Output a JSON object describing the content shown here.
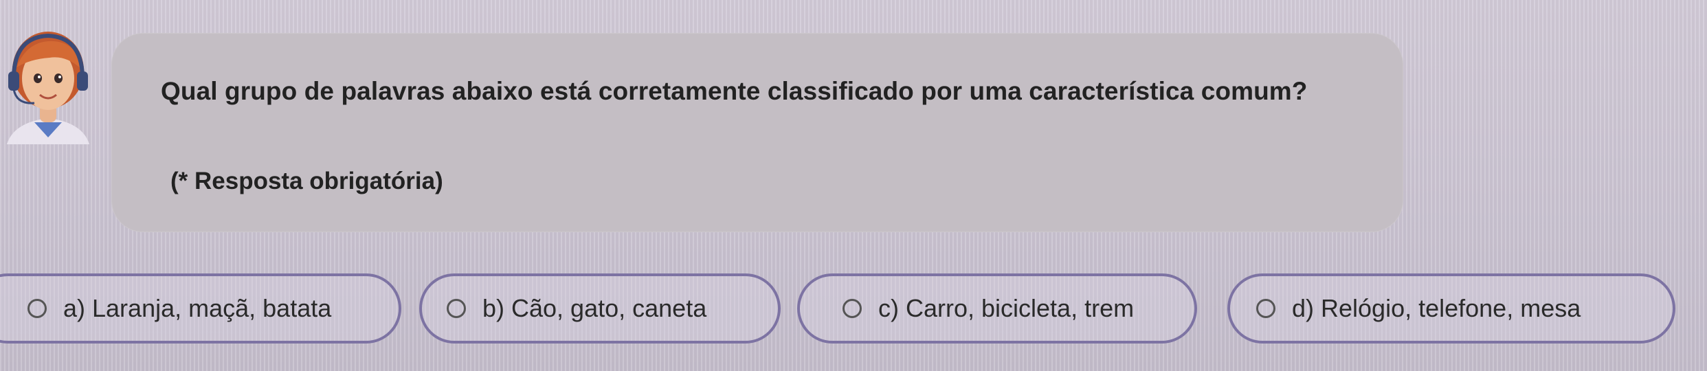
{
  "question": {
    "text": "Qual grupo de palavras abaixo está corretamente classificado por uma característica comum?",
    "required_note": "(* Resposta obrigatória)"
  },
  "options": [
    {
      "letter": "a",
      "label": "a) Laranja, maçã, batata",
      "selected": false
    },
    {
      "letter": "b",
      "label": "b) Cão, gato, caneta",
      "selected": false
    },
    {
      "letter": "c",
      "label": "c) Carro, bicicleta, trem",
      "selected": false
    },
    {
      "letter": "d",
      "label": "d) Relógio, telefone, mesa",
      "selected": false
    }
  ],
  "colors": {
    "background": "#cfc8d6",
    "bubble": "#c4bec4",
    "option_border": "#7d73a3",
    "text": "#222222"
  },
  "avatar": {
    "icon": "tutor-avatar-icon"
  }
}
